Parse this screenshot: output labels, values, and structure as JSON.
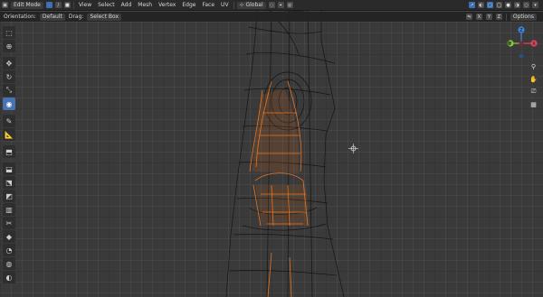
{
  "header": {
    "mode_label": "Edit Mode",
    "menus": [
      "View",
      "Select",
      "Add",
      "Mesh",
      "Vertex",
      "Edge",
      "Face",
      "UV"
    ],
    "transform_orientation": "Global",
    "options_label": "Options",
    "axes": [
      "X",
      "Y",
      "Z"
    ]
  },
  "tool_header": {
    "orientation_label": "Orientation:",
    "orientation_value": "Default",
    "drag_label": "Drag:",
    "drag_value": "Select Box"
  },
  "toolbar": {
    "tools": [
      "select-box",
      "cursor",
      "move",
      "rotate",
      "scale",
      "transform",
      "annotate",
      "measure",
      "add-cube",
      "extrude",
      "inset",
      "bevel",
      "loop-cut",
      "knife",
      "poly-build",
      "spin",
      "smooth",
      "shrink-fatten",
      "shear",
      "rip"
    ],
    "active_tool": "transform"
  },
  "gizmo": {
    "axes": [
      "X",
      "Y",
      "Z"
    ],
    "colors": {
      "x": "#e0455a",
      "y": "#8cc63f",
      "z": "#3d84e0"
    }
  },
  "colors": {
    "accent": "#4772b3",
    "selection_orange": "#ff7a1a",
    "wire": "#0e0e0e"
  }
}
